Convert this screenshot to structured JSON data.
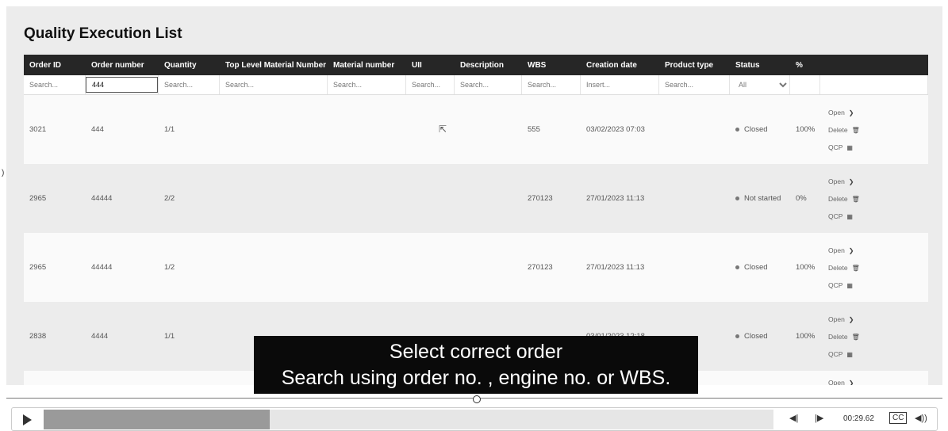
{
  "page": {
    "title": "Quality Execution List"
  },
  "columns": [
    "Order ID",
    "Order number",
    "Quantity",
    "Top Level Material Number",
    "Material number",
    "UII",
    "Description",
    "WBS",
    "Creation date",
    "Product type",
    "Status",
    "%"
  ],
  "filters": {
    "order_id": "Search...",
    "order_number_value": "444",
    "quantity": "Search...",
    "top_level": "Search...",
    "material": "Search...",
    "uii": "Search...",
    "description": "Search...",
    "wbs": "Search...",
    "creation": "Insert...",
    "product_type": "Search...",
    "status": "All"
  },
  "rows": [
    {
      "order_id": "3021",
      "order_number": "444",
      "quantity": "1/1",
      "wbs": "555",
      "date": "03/02/2023 07:03",
      "status": "Closed",
      "pct": "100%"
    },
    {
      "order_id": "2965",
      "order_number": "44444",
      "quantity": "2/2",
      "wbs": "270123",
      "date": "27/01/2023 11:13",
      "status": "Not started",
      "pct": "0%"
    },
    {
      "order_id": "2965",
      "order_number": "44444",
      "quantity": "1/2",
      "wbs": "270123",
      "date": "27/01/2023 11:13",
      "status": "Closed",
      "pct": "100%"
    },
    {
      "order_id": "2838",
      "order_number": "4444",
      "quantity": "1/1",
      "wbs": "",
      "date": "03/01/2023 12:18",
      "status": "Closed",
      "pct": "100%"
    }
  ],
  "actions": {
    "open": "Open",
    "delete": "Delete",
    "qcp": "QCP",
    "open_partial": "Open"
  },
  "caption": {
    "line1": "Select correct order",
    "line2": "Search using order no. , engine no. or WBS."
  },
  "player": {
    "time": "00:29.62",
    "cc": "CC",
    "progress": 0.31
  }
}
